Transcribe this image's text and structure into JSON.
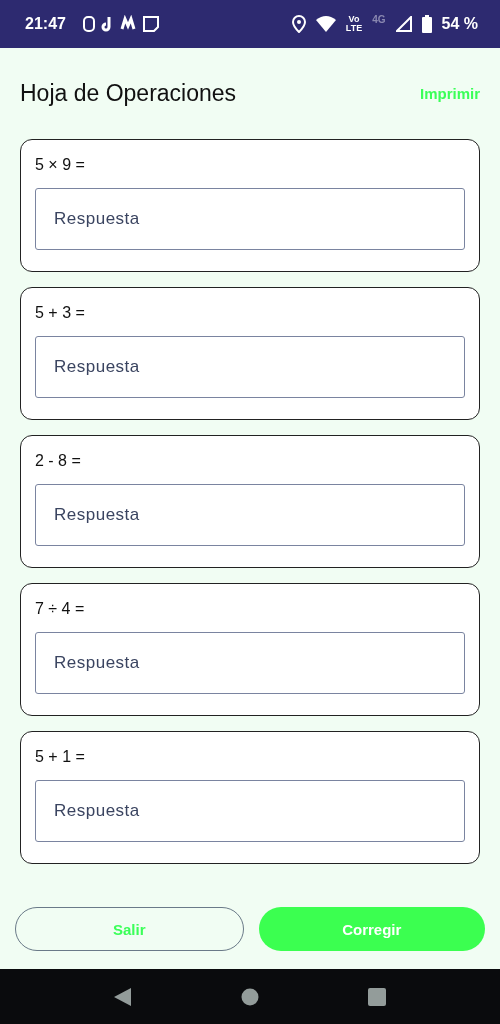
{
  "status_bar": {
    "time": "21:47",
    "volte": [
      "Vo",
      "LTE"
    ],
    "network": "4G",
    "battery": "54 %"
  },
  "header": {
    "title": "Hoja de Operaciones",
    "action": "Imprimir"
  },
  "questions": [
    {
      "prompt": "5 × 9 =",
      "placeholder": "Respuesta"
    },
    {
      "prompt": "5 + 3 =",
      "placeholder": "Respuesta"
    },
    {
      "prompt": "2 - 8 =",
      "placeholder": "Respuesta"
    },
    {
      "prompt": "7 ÷ 4 =",
      "placeholder": "Respuesta"
    },
    {
      "prompt": "5 + 1 =",
      "placeholder": "Respuesta"
    }
  ],
  "buttons": [
    {
      "label": "Salir",
      "kind": "outline"
    },
    {
      "label": "Corregir",
      "kind": "filled"
    }
  ]
}
